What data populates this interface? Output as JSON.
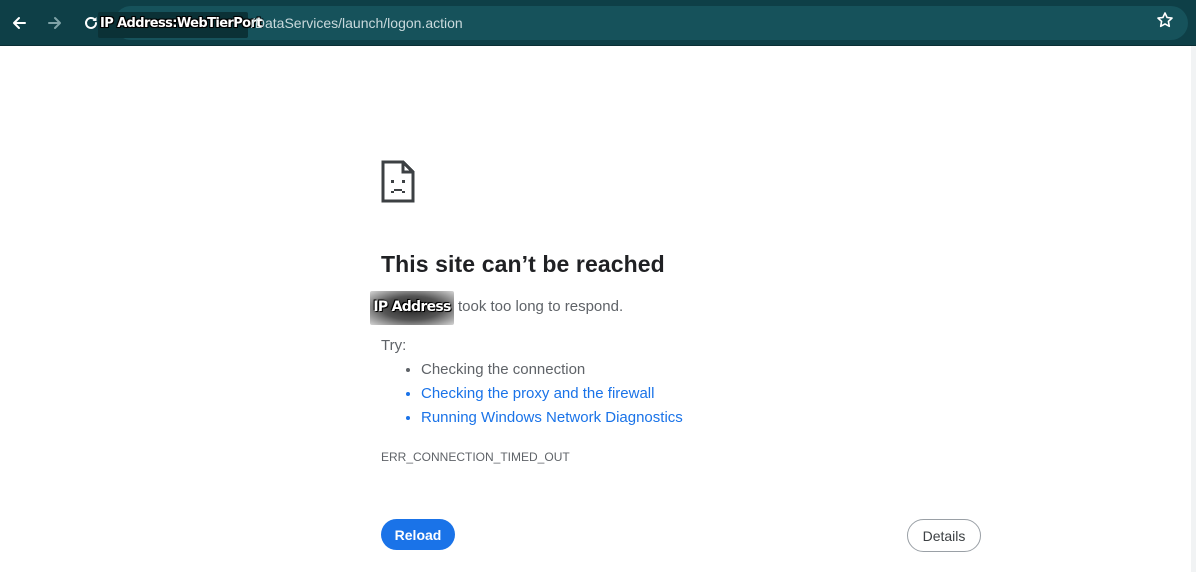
{
  "toolbar": {
    "url_host_redacted": "IP Address:WebTierPort",
    "url_path": "/DataServices/launch/logon.action",
    "colors": {
      "background": "#0e3f47",
      "omnibox": "#16525b"
    },
    "icons": [
      "back-arrow-icon",
      "forward-arrow-icon",
      "reload-icon",
      "site-info-icon",
      "star-icon"
    ]
  },
  "error": {
    "title": "This site can’t be reached",
    "host_redacted": "IP Address",
    "reason": "took too long to respond.",
    "try_label": "Try:",
    "suggestions": [
      {
        "label": "Checking the connection",
        "link": false
      },
      {
        "label": "Checking the proxy and the firewall",
        "link": true
      },
      {
        "label": "Running Windows Network Diagnostics",
        "link": true
      }
    ],
    "code": "ERR_CONNECTION_TIMED_OUT",
    "icon": "sad-page-icon"
  },
  "buttons": {
    "reload_label": "Reload",
    "details_label": "Details",
    "accent_color": "#1a73e8"
  }
}
